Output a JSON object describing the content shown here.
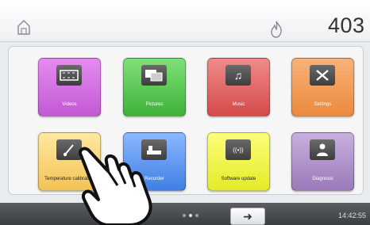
{
  "header": {
    "temperature": "403"
  },
  "tiles": [
    {
      "label": "Videos",
      "icon": "film-icon"
    },
    {
      "label": "Pictures",
      "icon": "pictures-icon"
    },
    {
      "label": "Music",
      "icon": "music-note-icon"
    },
    {
      "label": "Settings",
      "icon": "tools-icon"
    },
    {
      "label": "Temperature calibration",
      "icon": "thermometer-icon"
    },
    {
      "label": "Recorder",
      "icon": "recorder-icon"
    },
    {
      "label": "Software update",
      "icon": "update-icon"
    },
    {
      "label": "Diagnosis",
      "icon": "diagnosis-icon"
    }
  ],
  "music_glyph": "♫",
  "software_glyph": "((•))",
  "next_glyph": "➜",
  "footer": {
    "time": "14:42:55"
  },
  "colors": {
    "videos": "#d06de0",
    "pictures": "#53c24e",
    "music": "#e06060",
    "settings": "#f09a4f",
    "temperature_calibration": "#f7d074",
    "recorder": "#5b91ef",
    "software_update": "#eef040",
    "diagnosis": "#ab8ccb"
  }
}
